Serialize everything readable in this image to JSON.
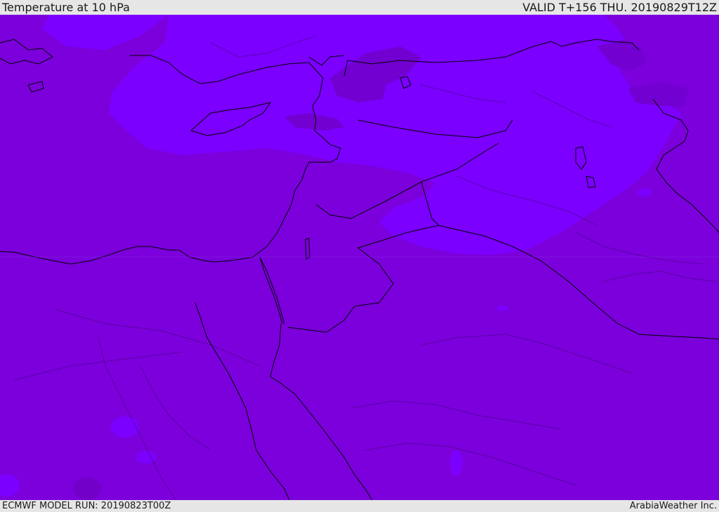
{
  "header": {
    "title": "Temperature at 10 hPa",
    "valid_time": "VALID T+156 THU. 20190829T12Z"
  },
  "footer": {
    "model_run": "ECMWF MODEL RUN: 20190823T00Z",
    "credit": "ArabiaWeather Inc."
  },
  "map": {
    "colors": {
      "base_fill": "#7b00dc",
      "warm_band_fill": "#7b00ff",
      "cool_patch_fill": "#7200c8",
      "coastline": "#000000",
      "boundary": "#3a0066"
    }
  }
}
